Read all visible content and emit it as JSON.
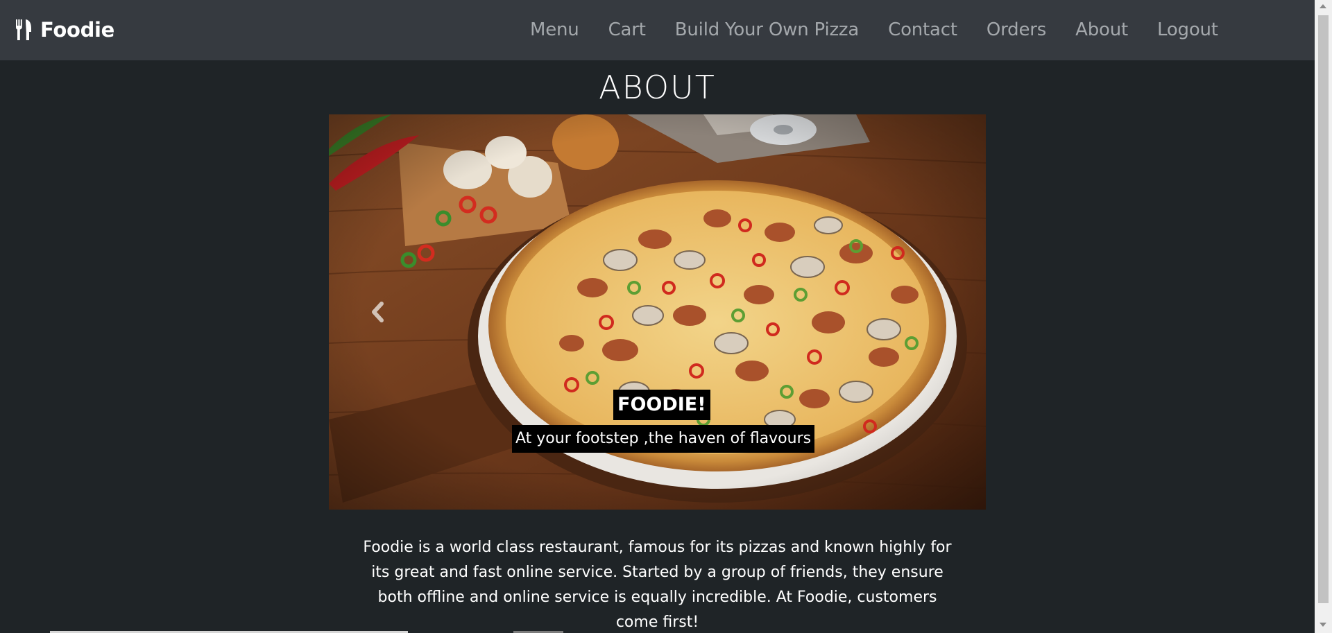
{
  "brand": {
    "icon": "utensils-icon",
    "name": "Foodie"
  },
  "nav": {
    "items": [
      {
        "label": "Menu"
      },
      {
        "label": "Cart"
      },
      {
        "label": "Build Your Own Pizza"
      },
      {
        "label": "Contact"
      },
      {
        "label": "Orders"
      },
      {
        "label": "About"
      },
      {
        "label": "Logout"
      }
    ]
  },
  "page": {
    "heading": "ABOUT"
  },
  "carousel": {
    "image": "pizza-photo",
    "prev_icon": "chevron-left-icon",
    "caption_title": "FOODIE!",
    "caption_subtitle": "At your footstep ,the haven of flavours"
  },
  "description": "Foodie is a world class restaurant, famous for its pizzas and known highly for its great and fast online service. Started by a group of friends, they ensure both offline and online service is equally incredible. At Foodie, customers come first!",
  "colors": {
    "navbar_bg": "#363a40",
    "page_bg": "#1f2427",
    "nav_link": "#a4a8ac",
    "text": "#ffffff",
    "caption_bg": "#000000"
  }
}
